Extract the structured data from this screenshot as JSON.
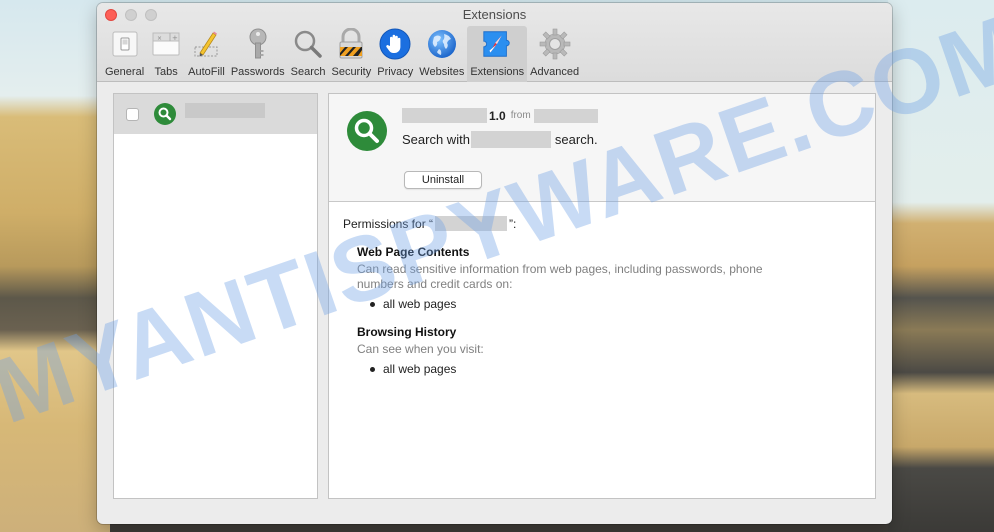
{
  "window": {
    "title": "Extensions",
    "traffic_lights": [
      "close",
      "minimize",
      "zoom"
    ]
  },
  "toolbar": {
    "items": [
      {
        "label": "General",
        "icon": "general-switch-icon"
      },
      {
        "label": "Tabs",
        "icon": "tabs-icon"
      },
      {
        "label": "AutoFill",
        "icon": "pencil-icon"
      },
      {
        "label": "Passwords",
        "icon": "key-icon"
      },
      {
        "label": "Search",
        "icon": "magnifier-icon"
      },
      {
        "label": "Security",
        "icon": "padlock-icon"
      },
      {
        "label": "Privacy",
        "icon": "hand-icon"
      },
      {
        "label": "Websites",
        "icon": "globe-icon"
      },
      {
        "label": "Extensions",
        "icon": "puzzle-compass-icon"
      },
      {
        "label": "Advanced",
        "icon": "gear-icon"
      }
    ],
    "active": "Extensions"
  },
  "extension_list": {
    "items": [
      {
        "name_redacted": true,
        "enabled": false,
        "icon": "green-search-icon",
        "selected": true
      }
    ]
  },
  "detail": {
    "version": "1.0",
    "from_label": "from",
    "description_prefix": "Search with",
    "description_suffix": "search.",
    "uninstall_label": "Uninstall",
    "permissions_prefix": "Permissions for “",
    "permissions_suffix": "”:",
    "sections": [
      {
        "heading": "Web Page Contents",
        "description": "Can read sensitive information from web pages, including passwords, phone numbers and credit cards on:",
        "items": [
          "all web pages"
        ]
      },
      {
        "heading": "Browsing History",
        "description": "Can see when you visit:",
        "items": [
          "all web pages"
        ]
      }
    ]
  },
  "colors": {
    "accent_green": "#2e8b3a",
    "close_red": "#fd5f57",
    "watermark_blue": "#6ea0e6"
  },
  "watermark": "MYANTISPYWARE.COM"
}
